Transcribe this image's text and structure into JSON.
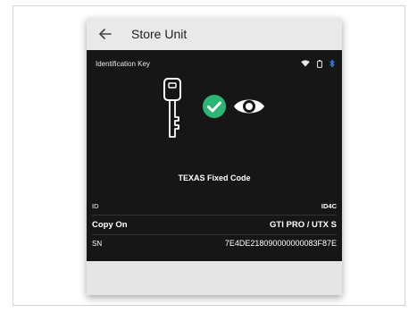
{
  "app": {
    "title": "Store Unit"
  },
  "status": {
    "label": "Identification Key",
    "icons": [
      "wifi-icon",
      "battery-icon",
      "bluetooth-icon"
    ]
  },
  "hero": {
    "icons": [
      "car-key-icon",
      "check-circle-icon",
      "eye-icon"
    ],
    "code_type": "TEXAS Fixed Code"
  },
  "details": {
    "id": {
      "label": "ID",
      "value": "ID4C"
    },
    "copy_on": {
      "label": "Copy On",
      "value": "GTI PRO / UTX S"
    },
    "sn": {
      "label": "SN",
      "value": "7E4DE218090000000083F87E"
    }
  },
  "colors": {
    "accent_check": "#2bb673",
    "bluetooth": "#2b8ef0",
    "screen_bg": "#161616",
    "appbar_bg": "#e9e9e9"
  }
}
